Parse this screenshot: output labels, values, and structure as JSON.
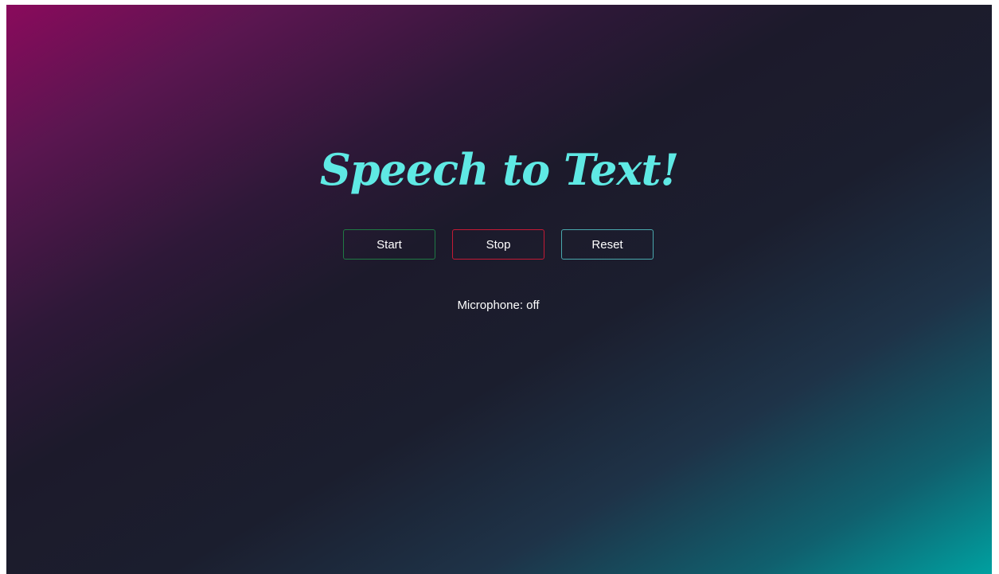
{
  "header": {
    "title": "Speech to Text!"
  },
  "controls": {
    "start_label": "Start",
    "stop_label": "Stop",
    "reset_label": "Reset"
  },
  "status": {
    "microphone_text": "Microphone: off"
  },
  "colors": {
    "title": "#5fe9e4",
    "start_border": "#1f7a44",
    "stop_border": "#c41a35",
    "reset_border": "#4aa8ad"
  }
}
